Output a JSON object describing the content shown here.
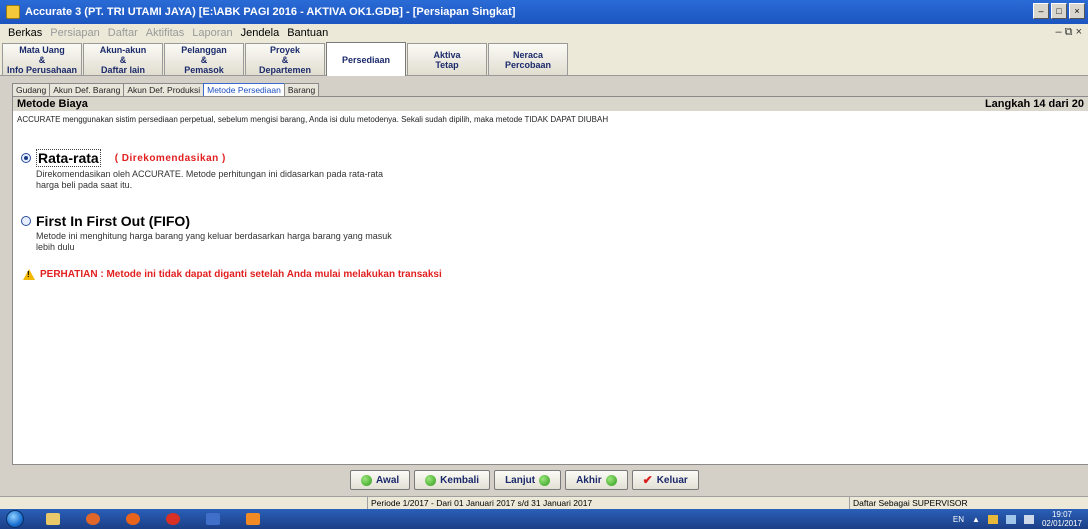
{
  "window": {
    "title": "Accurate 3  (PT. TRI UTAMI JAYA)  [E:\\ABK PAGI 2016 - AKTIVA OK1.GDB] - [Persiapan Singkat]",
    "min_glyph": "–",
    "max_glyph": "□",
    "close_glyph": "×",
    "mdi_controls": "– ⧉ ×"
  },
  "menu": [
    {
      "label": "Berkas",
      "enabled": true
    },
    {
      "label": "Persiapan",
      "enabled": false
    },
    {
      "label": "Daftar",
      "enabled": false
    },
    {
      "label": "Aktifitas",
      "enabled": false
    },
    {
      "label": "Laporan",
      "enabled": false
    },
    {
      "label": "Jendela",
      "enabled": true
    },
    {
      "label": "Bantuan",
      "enabled": true
    }
  ],
  "top_tabs": [
    {
      "line1": "Mata Uang",
      "line2": "&",
      "line3": "Info Perusahaan"
    },
    {
      "line1": "Akun-akun",
      "line2": "&",
      "line3": "Daftar lain"
    },
    {
      "line1": "Pelanggan",
      "line2": "&",
      "line3": "Pemasok"
    },
    {
      "line1": "Proyek",
      "line2": "&",
      "line3": "Departemen"
    },
    {
      "line1": "Persediaan",
      "line2": "",
      "line3": ""
    },
    {
      "line1": "Aktiva",
      "line2": "Tetap",
      "line3": ""
    },
    {
      "line1": "Neraca",
      "line2": "Percobaan",
      "line3": ""
    }
  ],
  "sub_tabs": [
    "Gudang",
    "Akun Def. Barang",
    "Akun Def. Produksi",
    "Metode Persediaan",
    "Barang"
  ],
  "panel": {
    "heading": "Metode Biaya",
    "step": "Langkah 14 dari 20",
    "description": "ACCURATE menggunakan sistim persediaan perpetual, sebelum mengisi barang, Anda isi dulu metodenya. Sekali sudah dipilih, maka metode TIDAK DAPAT DIUBAH",
    "option1": {
      "label": "Rata-rata",
      "recommended": "( Direkomendasikan )",
      "desc1": "Direkomendasikan oleh ACCURATE. Metode perhitungan ini didasarkan pada rata-rata",
      "desc2": "harga beli pada saat itu."
    },
    "option2": {
      "label": "First In First Out (FIFO)",
      "desc1": "Metode ini menghitung harga barang yang keluar berdasarkan harga barang yang masuk",
      "desc2": "lebih dulu"
    },
    "warning": "PERHATIAN : Metode ini tidak dapat diganti setelah Anda mulai melakukan transaksi"
  },
  "nav_buttons": {
    "awal": "Awal",
    "kembali": "Kembali",
    "lanjut": "Lanjut",
    "akhir": "Akhir",
    "keluar": "Keluar",
    "check_glyph": "✔"
  },
  "status": {
    "period": "Periode 1/2017 - Dari 01 Januari 2017 s/d 31 Januari 2017",
    "user": "Daftar Sebagai SUPERVISOR"
  },
  "taskbar": {
    "lang": "EN",
    "tray_arrow": "▲",
    "clock_time": "19:07",
    "clock_date": "02/01/2017"
  },
  "colors": {
    "warning_red": "#e22020",
    "title_blue": "#1c55c0",
    "active_subtab": "#1a4ec0"
  }
}
